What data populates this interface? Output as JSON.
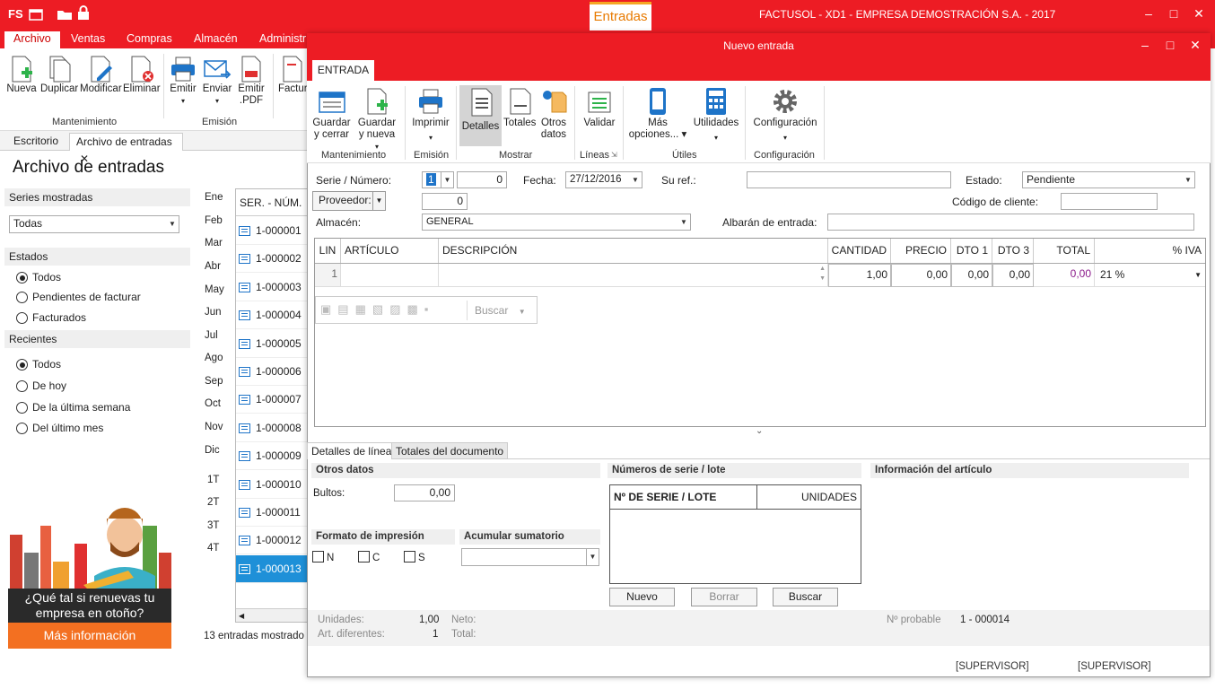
{
  "app": {
    "logo": "FS",
    "window_title": "FACTUSOL - XD1 - EMPRESA DEMOSTRACIÓN S.A. - 2017",
    "context_tab": "Entradas",
    "accent_color": "#ed1c24"
  },
  "menu": [
    "Archivo",
    "Ventas",
    "Compras",
    "Almacén",
    "Administr"
  ],
  "ribbon_main": {
    "buttons": [
      {
        "label": "Nueva",
        "icon": "new-document-icon"
      },
      {
        "label": "Duplicar",
        "icon": "duplicate-icon"
      },
      {
        "label": "Modificar",
        "icon": "edit-icon"
      },
      {
        "label": "Eliminar",
        "icon": "delete-icon"
      },
      {
        "label": "Emitir",
        "icon": "printer-icon"
      },
      {
        "label": "Enviar",
        "icon": "email-icon"
      },
      {
        "label": "Emitir .PDF",
        "icon": "pdf-icon"
      },
      {
        "label": "Factur",
        "icon": "invoice-icon"
      }
    ],
    "groups": [
      "Mantenimiento",
      "Emisión"
    ]
  },
  "doc_tabs": [
    "Escritorio",
    "Archivo de entradas"
  ],
  "page_title": "Archivo de entradas",
  "filters": {
    "series_label": "Series mostradas",
    "series_value": "Todas",
    "estados_label": "Estados",
    "estados": [
      {
        "label": "Todos",
        "checked": true
      },
      {
        "label": "Pendientes de facturar",
        "checked": false
      },
      {
        "label": "Facturados",
        "checked": false
      }
    ],
    "recientes_label": "Recientes",
    "recientes": [
      {
        "label": "Todos",
        "checked": true
      },
      {
        "label": "De hoy",
        "checked": false
      },
      {
        "label": "De la última semana",
        "checked": false
      },
      {
        "label": "Del último mes",
        "checked": false
      }
    ]
  },
  "months": [
    "Ene",
    "Feb",
    "Mar",
    "Abr",
    "May",
    "Jun",
    "Jul",
    "Ago",
    "Sep",
    "Oct",
    "Nov",
    "Dic",
    "1T",
    "2T",
    "3T",
    "4T"
  ],
  "list": {
    "header": "SER. - NÚM.",
    "rows": [
      "1-000001",
      "1-000002",
      "1-000003",
      "1-000004",
      "1-000005",
      "1-000006",
      "1-000007",
      "1-000008",
      "1-000009",
      "1-000010",
      "1-000011",
      "1-000012",
      "1-000013"
    ],
    "selected": 12,
    "footer": "13 entradas mostrado"
  },
  "promo": {
    "text": "¿Qué tal si renuevas tu empresa en otoño?",
    "button": "Más información"
  },
  "modal": {
    "title": "Nuevo entrada",
    "tab": "ENTRADA",
    "ribbon": {
      "buttons": [
        {
          "label": "Guardar y cerrar",
          "icon": "save-close-icon"
        },
        {
          "label": "Guardar y nueva",
          "icon": "save-new-icon"
        },
        {
          "label": "Imprimir",
          "icon": "printer-icon"
        },
        {
          "label": "Detalles",
          "icon": "details-icon"
        },
        {
          "label": "Totales",
          "icon": "totals-icon"
        },
        {
          "label": "Otros datos",
          "icon": "other-data-icon"
        },
        {
          "label": "Validar",
          "icon": "validate-icon"
        },
        {
          "label": "Más opciones...",
          "icon": "mobile-icon"
        },
        {
          "label": "Utilidades",
          "icon": "calculator-icon"
        },
        {
          "label": "Configuración",
          "icon": "gear-icon"
        }
      ],
      "groups": [
        "Mantenimiento",
        "Emisión",
        "Mostrar",
        "Líneas",
        "Útiles",
        "Configuración"
      ]
    },
    "form": {
      "serie_label": "Serie / Número:",
      "serie_value": "1",
      "numero_value": "0",
      "fecha_label": "Fecha:",
      "fecha_value": "27/12/2016",
      "suref_label": "Su ref.:",
      "estado_label": "Estado:",
      "estado_value": "Pendiente",
      "proveedor_label": "Proveedor:",
      "proveedor_value": "0",
      "codigo_cliente_label": "Código de cliente:",
      "almacen_label": "Almacén:",
      "almacen_value": "GENERAL",
      "albaran_label": "Albarán de entrada:"
    },
    "grid": {
      "headers": [
        "LIN",
        "ARTÍCULO",
        "DESCRIPCIÓN",
        "CANTIDAD",
        "PRECIO",
        "DTO 1",
        "DTO 3",
        "TOTAL",
        "% IVA"
      ],
      "row": {
        "lin": "1",
        "articulo": "",
        "descripcion": "",
        "cantidad": "1,00",
        "precio": "0,00",
        "dto1": "0,00",
        "dto3": "0,00",
        "total": "0,00",
        "iva": "21 %"
      },
      "search_label": "Buscar"
    },
    "bottom_tabs": [
      "Detalles de línea",
      "Totales del documento"
    ],
    "otros_datos": {
      "title": "Otros datos",
      "bultos_label": "Bultos:",
      "bultos_value": "0,00",
      "formato_title": "Formato de impresión",
      "formato_options": [
        "N",
        "C",
        "S"
      ],
      "acumular_title": "Acumular sumatorio"
    },
    "series_lote": {
      "title": "Números de serie / lote",
      "col1": "Nº DE SERIE / LOTE",
      "col2": "UNIDADES",
      "buttons": [
        "Nuevo",
        "Borrar",
        "Buscar"
      ]
    },
    "info_articulo": "Información del artículo",
    "status": {
      "unidades_label": "Unidades:",
      "unidades_value": "1,00",
      "art_label": "Art. diferentes:",
      "art_value": "1",
      "neto_label": "Neto:",
      "total_label": "Total:",
      "probable_label": "Nº probable",
      "probable_value": "1 - 000014",
      "user1": "[SUPERVISOR]",
      "user2": "[SUPERVISOR]"
    }
  }
}
